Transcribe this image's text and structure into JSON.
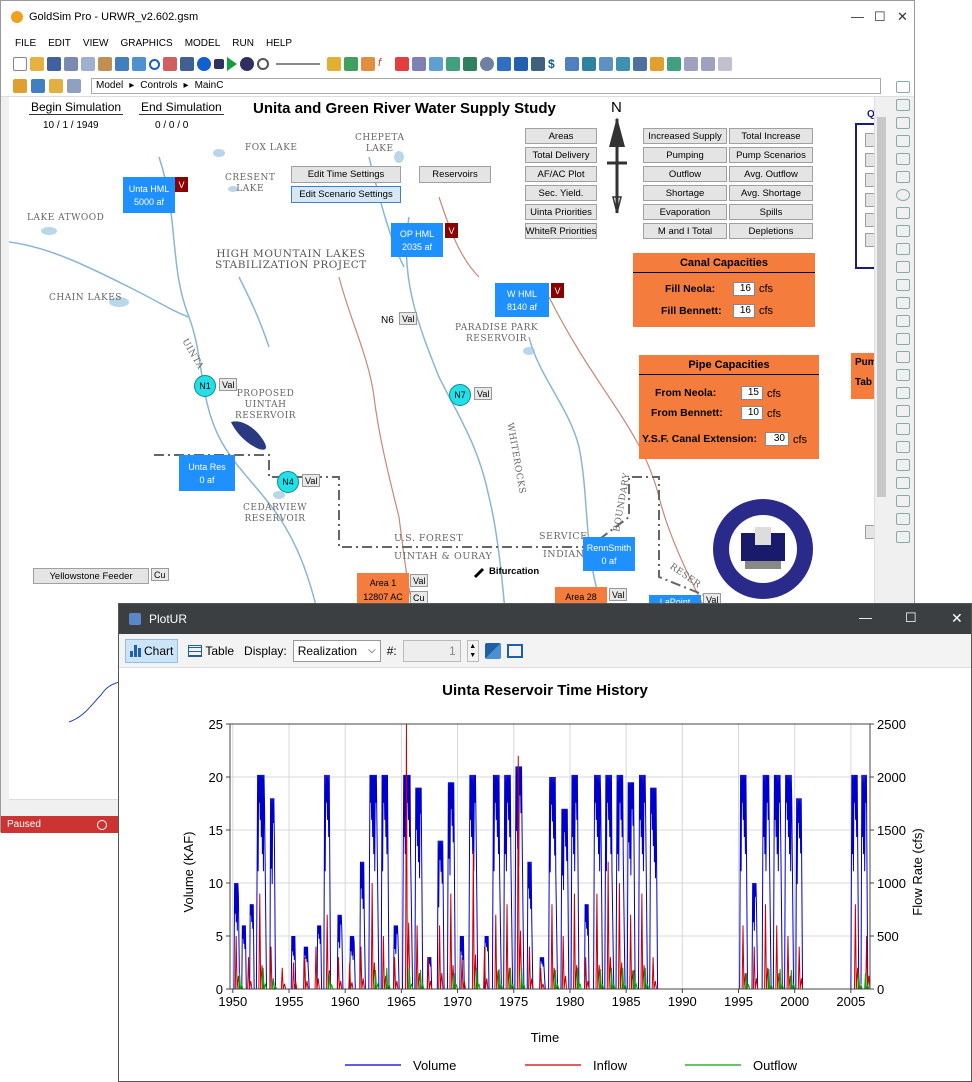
{
  "window": {
    "title": "GoldSim Pro - URWR_v2.602.gsm",
    "menu": [
      "FILE",
      "EDIT",
      "VIEW",
      "GRAPHICS",
      "MODEL",
      "RUN",
      "HELP"
    ],
    "breadcrumb": [
      "Model",
      "Controls",
      "MainC"
    ],
    "status": "Paused"
  },
  "sim": {
    "begin_label": "Begin Simulation",
    "end_label": "End Simulation",
    "begin_value": "10 /  1  / 1949",
    "end_value": "0 /  0  / 0"
  },
  "study_title": "Unita and Green River Water Supply Study",
  "north": "N",
  "map_labels": {
    "fox_lake": "FOX LAKE",
    "cresent_lake": "CRESENT\nLAKE",
    "chepeta_lake": "CHEPETA\nLAKE",
    "lake_atwood": "LAKE ATWOOD",
    "chain_lakes": "CHAIN LAKES",
    "project": "HIGH MOUNTAIN LAKES\nSTABILIZATION PROJECT",
    "uinta": "UINTA",
    "proposed": "PROPOSED\nUINTAH\nRESERVOIR",
    "paradise": "PARADISE PARK\nRESERVOIR",
    "cedarview": "CEDARVIEW\nRESERVOIR",
    "us_forest": "U.S. FOREST",
    "uintah_ouray": "UINTAH & OURAY",
    "service": "SERVICE",
    "indian": "INDIAN",
    "whiterocks": "WHITEROCKS",
    "boundary": "BOUNDARY",
    "reserve": "RESER",
    "bifurcation": "Bifurcation",
    "seal": "CENTRAL UTAH WATER CONSERVANCY DISTRICT"
  },
  "buttons": {
    "edit_time": "Edit Time Settings",
    "edit_scenario": "Edit Scenario Settings",
    "reservoirs": "Reservoirs",
    "col1": [
      "Areas",
      "Total Delivery",
      "AF/AC Plot",
      "Sec. Yield.",
      "Uinta Priorities",
      "WhiteR Priorities"
    ],
    "col2": [
      "Increased Supply",
      "Pumping",
      "Outflow",
      "Shortage",
      "Evaporation",
      "M and I Total"
    ],
    "col3": [
      "Total Increase",
      "Pump Scenarios",
      "Avg. Outflow",
      "Avg. Shortage",
      "Spills",
      "Depletions"
    ],
    "yellowstone": "Yellowstone Feeder"
  },
  "blue_boxes": {
    "unta_hml": {
      "name": "Unta HML",
      "value": "5000 af"
    },
    "op_hml": {
      "name": "OP HML",
      "value": "2035 af"
    },
    "w_hml": {
      "name": "W HML",
      "value": "8140 af"
    },
    "unta_res": {
      "name": "Unta Res",
      "value": "0 af"
    },
    "rennsmith": {
      "name": "RennSmith",
      "value": "0 af"
    },
    "lapoint": {
      "name": "LaPoint"
    }
  },
  "orange_boxes": {
    "area1": {
      "name": "Area 1",
      "value": "12807 AC"
    },
    "area28": {
      "name": "Area 28"
    }
  },
  "v_label": "V",
  "val_label": "Val",
  "cu_label": "Cu",
  "nodes": {
    "n1": "N1",
    "n4": "N4",
    "n6": "N6",
    "n7": "N7"
  },
  "canal": {
    "title": "Canal Capacities",
    "rows": [
      {
        "label": "Fill Neola:",
        "value": "16",
        "unit": "cfs"
      },
      {
        "label": "Fill Bennett:",
        "value": "16",
        "unit": "cfs"
      }
    ]
  },
  "pipe": {
    "title": "Pipe Capacities",
    "rows": [
      {
        "label": "From Neola:",
        "value": "15",
        "unit": "cfs"
      },
      {
        "label": "From Bennett:",
        "value": "10",
        "unit": "cfs"
      },
      {
        "label": "Y.S.F. Canal Extension:",
        "value": "30",
        "unit": "cfs"
      }
    ]
  },
  "clipped": {
    "q": "Q",
    "pum": "Pum",
    "tab": "Tab"
  },
  "plot": {
    "title": "PlotUR",
    "chart_btn": "Chart",
    "table_btn": "Table",
    "display_label": "Display:",
    "display_value": "Realization",
    "num_label": "#:",
    "num_value": "1"
  },
  "chart_data": {
    "type": "line",
    "title": "Uinta Reservoir Time History",
    "xlabel": "Time",
    "ylabel": "Volume (KAF)",
    "y2label": "Flow Rate (cfs)",
    "xlim": [
      1949.75,
      2006.7
    ],
    "ylim": [
      0,
      25
    ],
    "y2lim": [
      0,
      2500
    ],
    "xticks": [
      1950,
      1955,
      1960,
      1965,
      1970,
      1975,
      1980,
      1985,
      1990,
      1995,
      2000,
      2005
    ],
    "yticks": [
      0,
      5,
      10,
      15,
      20,
      25
    ],
    "y2ticks": [
      0,
      500,
      1000,
      1500,
      2000,
      2500
    ],
    "grid": true,
    "legend_position": "bottom",
    "series": [
      {
        "name": "Volume",
        "axis": "left",
        "color": "#0000cc",
        "episodes": [
          [
            1950.1,
            1950.6,
            10
          ],
          [
            1950.8,
            1951.2,
            6
          ],
          [
            1951.5,
            1951.9,
            8
          ],
          [
            1952.1,
            1953.0,
            20.2
          ],
          [
            1953.3,
            1953.8,
            18
          ],
          [
            1955.2,
            1955.6,
            5
          ],
          [
            1956.3,
            1956.8,
            4
          ],
          [
            1957.5,
            1957.9,
            6
          ],
          [
            1958.1,
            1958.7,
            20.2
          ],
          [
            1959.3,
            1959.8,
            7
          ],
          [
            1960.4,
            1960.9,
            5
          ],
          [
            1961.3,
            1961.8,
            12
          ],
          [
            1962.1,
            1963.0,
            20.2
          ],
          [
            1963.2,
            1963.9,
            20.2
          ],
          [
            1964.3,
            1964.8,
            6
          ],
          [
            1965.1,
            1966.0,
            20.2
          ],
          [
            1966.2,
            1966.9,
            19
          ],
          [
            1967.3,
            1967.7,
            3
          ],
          [
            1968.2,
            1968.8,
            14
          ],
          [
            1969.1,
            1969.8,
            19.5
          ],
          [
            1970.2,
            1970.6,
            5
          ],
          [
            1971.0,
            1971.8,
            20.2
          ],
          [
            1972.4,
            1972.8,
            5
          ],
          [
            1973.1,
            1973.9,
            20.2
          ],
          [
            1974.1,
            1974.9,
            20.2
          ],
          [
            1975.1,
            1975.9,
            21
          ],
          [
            1976.2,
            1976.7,
            12
          ],
          [
            1977.3,
            1977.8,
            3
          ],
          [
            1978.1,
            1978.9,
            20
          ],
          [
            1979.2,
            1979.9,
            17
          ],
          [
            1980.1,
            1980.8,
            20.2
          ],
          [
            1981.3,
            1981.7,
            8
          ],
          [
            1982.1,
            1982.9,
            20.2
          ],
          [
            1983.1,
            1983.9,
            20.2
          ],
          [
            1984.1,
            1984.9,
            20.2
          ],
          [
            1985.1,
            1985.8,
            19.5
          ],
          [
            1986.1,
            1986.9,
            20.2
          ],
          [
            1987.1,
            1987.8,
            19
          ],
          [
            1995.1,
            1995.8,
            20.2
          ],
          [
            1996.2,
            1996.7,
            10
          ],
          [
            1997.1,
            1997.9,
            20.2
          ],
          [
            1998.1,
            1998.9,
            20.2
          ],
          [
            1999.1,
            1999.9,
            20.2
          ],
          [
            2000.1,
            2000.7,
            18
          ],
          [
            2005.0,
            2005.7,
            20.2
          ],
          [
            2005.9,
            2006.5,
            20.2
          ]
        ]
      },
      {
        "name": "Inflow",
        "axis": "right",
        "color": "#cc0000",
        "spikes": [
          [
            1950.3,
            500
          ],
          [
            1951.4,
            300
          ],
          [
            1952.4,
            900
          ],
          [
            1953.4,
            400
          ],
          [
            1954.4,
            200
          ],
          [
            1955.4,
            250
          ],
          [
            1956.4,
            300
          ],
          [
            1957.4,
            400
          ],
          [
            1958.4,
            700
          ],
          [
            1959.4,
            300
          ],
          [
            1960.4,
            250
          ],
          [
            1961.4,
            400
          ],
          [
            1962.4,
            1000
          ],
          [
            1963.4,
            500
          ],
          [
            1964.4,
            300
          ],
          [
            1965.45,
            2500
          ],
          [
            1966.4,
            600
          ],
          [
            1967.4,
            300
          ],
          [
            1968.4,
            600
          ],
          [
            1969.4,
            900
          ],
          [
            1970.4,
            300
          ],
          [
            1971.4,
            1300
          ],
          [
            1972.4,
            400
          ],
          [
            1973.4,
            700
          ],
          [
            1974.4,
            800
          ],
          [
            1975.4,
            2200
          ],
          [
            1976.4,
            400
          ],
          [
            1977.4,
            200
          ],
          [
            1978.4,
            800
          ],
          [
            1979.4,
            500
          ],
          [
            1980.4,
            900
          ],
          [
            1981.4,
            300
          ],
          [
            1982.4,
            900
          ],
          [
            1983.4,
            1200
          ],
          [
            1984.4,
            1000
          ],
          [
            1985.4,
            700
          ],
          [
            1986.4,
            900
          ],
          [
            1987.4,
            300
          ],
          [
            1995.4,
            600
          ],
          [
            1996.4,
            400
          ],
          [
            1997.4,
            800
          ],
          [
            1998.4,
            600
          ],
          [
            1999.4,
            500
          ],
          [
            2000.4,
            400
          ],
          [
            2005.4,
            800
          ],
          [
            2006.4,
            500
          ]
        ]
      },
      {
        "name": "Outflow",
        "axis": "right",
        "color": "#00aa00",
        "spikes": [
          [
            1950.6,
            150
          ],
          [
            1952.7,
            200
          ],
          [
            1953.6,
            100
          ],
          [
            1958.6,
            150
          ],
          [
            1962.7,
            180
          ],
          [
            1963.7,
            200
          ],
          [
            1965.7,
            200
          ],
          [
            1966.7,
            180
          ],
          [
            1969.7,
            150
          ],
          [
            1971.7,
            200
          ],
          [
            1973.7,
            190
          ],
          [
            1974.7,
            200
          ],
          [
            1975.7,
            200
          ],
          [
            1978.7,
            180
          ],
          [
            1980.7,
            200
          ],
          [
            1982.7,
            190
          ],
          [
            1983.7,
            200
          ],
          [
            1984.7,
            200
          ],
          [
            1985.7,
            180
          ],
          [
            1986.7,
            200
          ],
          [
            1995.7,
            150
          ],
          [
            1997.7,
            190
          ],
          [
            1998.7,
            190
          ],
          [
            1999.7,
            180
          ],
          [
            2005.7,
            150
          ],
          [
            2006.3,
            150
          ]
        ]
      }
    ]
  }
}
